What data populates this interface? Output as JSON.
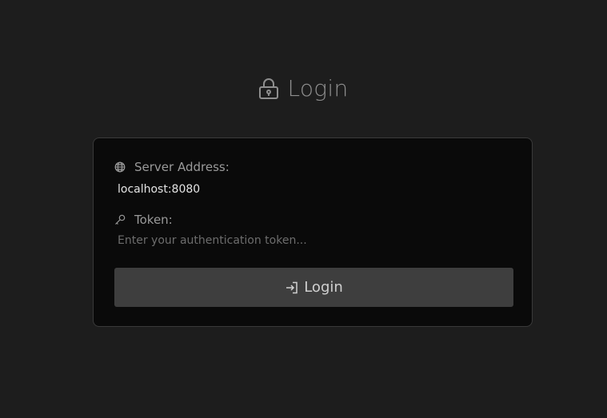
{
  "header": {
    "icon": "lock-icon",
    "title": "Login"
  },
  "form": {
    "server": {
      "icon": "globe-icon",
      "label": "Server Address:",
      "value": "localhost:8080"
    },
    "token": {
      "icon": "key-icon",
      "label": "Token:",
      "placeholder": "Enter your authentication token..."
    },
    "submit": {
      "icon": "sign-in-icon",
      "label": "Login"
    }
  },
  "colors": {
    "background": "#1d1d1d",
    "card": "#0a0a0a",
    "button": "#3e3e3e"
  }
}
